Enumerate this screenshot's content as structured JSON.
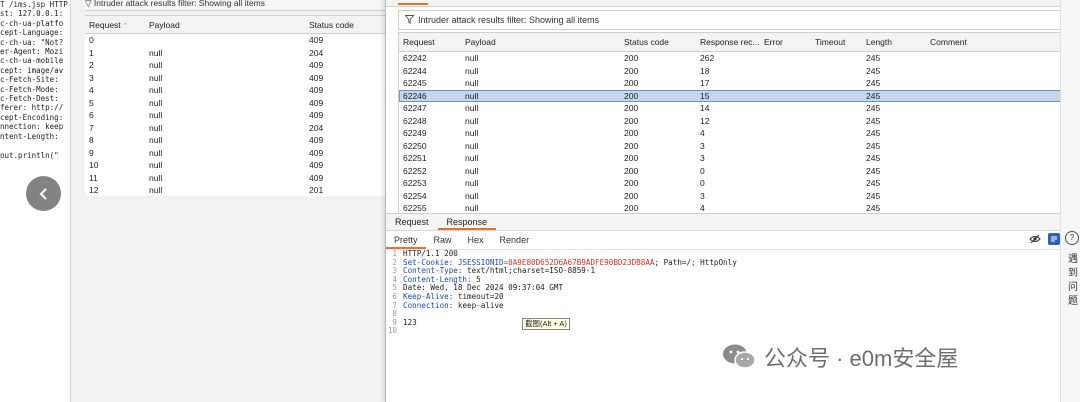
{
  "left_pane": {
    "lines": [
      "T /ims.jsp HTTP",
      "st: 127.0.0.1:",
      "c-ch-ua-platfo",
      "cept-Language:",
      "c-ch-ua: \"Not?",
      "er-Agent: Mozi",
      "c-ch-ua-mobile",
      "cept: image/av",
      "c-Fetch-Site:",
      "c-Fetch-Mode:",
      "c-Fetch-Dest:",
      "ferer: http://",
      "cept-Encoding:",
      "nnection: keep",
      "ntent-Length:"
    ],
    "code_line": " out.println(\""
  },
  "bg_window": {
    "filter_text": "Intruder attack results filter: Showing all items",
    "columns": [
      "Request",
      "Payload",
      "Status code"
    ],
    "rows": [
      [
        "0",
        "",
        "409"
      ],
      [
        "1",
        "null",
        "204"
      ],
      [
        "2",
        "null",
        "409"
      ],
      [
        "3",
        "null",
        "409"
      ],
      [
        "4",
        "null",
        "409"
      ],
      [
        "5",
        "null",
        "409"
      ],
      [
        "6",
        "null",
        "409"
      ],
      [
        "7",
        "null",
        "204"
      ],
      [
        "8",
        "null",
        "409"
      ],
      [
        "9",
        "null",
        "409"
      ],
      [
        "10",
        "null",
        "409"
      ],
      [
        "11",
        "null",
        "409"
      ],
      [
        "12",
        "null",
        "201"
      ]
    ]
  },
  "fg_window": {
    "filter_text": "Intruder attack results filter: Showing all items",
    "columns": [
      "Request",
      "Payload",
      "Status code",
      "Response rec...",
      "Error",
      "Timeout",
      "Length",
      "Comment"
    ],
    "rows": [
      [
        "62242",
        "null",
        "200",
        "262",
        "",
        "",
        "245",
        ""
      ],
      [
        "62244",
        "null",
        "200",
        "18",
        "",
        "",
        "245",
        ""
      ],
      [
        "62245",
        "null",
        "200",
        "17",
        "",
        "",
        "245",
        ""
      ],
      [
        "62246",
        "null",
        "200",
        "15",
        "",
        "",
        "245",
        ""
      ],
      [
        "62247",
        "null",
        "200",
        "14",
        "",
        "",
        "245",
        ""
      ],
      [
        "62248",
        "null",
        "200",
        "12",
        "",
        "",
        "245",
        ""
      ],
      [
        "62249",
        "null",
        "200",
        "4",
        "",
        "",
        "245",
        ""
      ],
      [
        "62250",
        "null",
        "200",
        "3",
        "",
        "",
        "245",
        ""
      ],
      [
        "62251",
        "null",
        "200",
        "3",
        "",
        "",
        "245",
        ""
      ],
      [
        "62252",
        "null",
        "200",
        "0",
        "",
        "",
        "245",
        ""
      ],
      [
        "62253",
        "null",
        "200",
        "0",
        "",
        "",
        "245",
        ""
      ],
      [
        "62254",
        "null",
        "200",
        "3",
        "",
        "",
        "245",
        ""
      ],
      [
        "62255",
        "null",
        "200",
        "4",
        "",
        "",
        "245",
        ""
      ]
    ],
    "selected_row": "62246",
    "panel_tabs": [
      "Request",
      "Response"
    ],
    "active_panel_tab": "Response",
    "sub_tabs": [
      "Pretty",
      "Raw",
      "Hex",
      "Render"
    ],
    "active_sub_tab": "Pretty",
    "response": {
      "status_line": "HTTP/1.1 200",
      "set_cookie_name": "Set-Cookie:",
      "set_cookie_id": "JSESSIONID",
      "set_cookie_value": "=0A9E80D652D6A67B9ADFE90BD23DB8AA",
      "set_cookie_rest": "; Path=/; HttpOnly",
      "content_type_name": "Content-Type:",
      "content_type_value": "text/html;charset=ISO-8859-1",
      "content_length_name": "Content-Length:",
      "content_length_value": "5",
      "date_line": "Date: Wed, 18 Dec 2024 09:37:04 GMT",
      "keep_alive_name": "Keep-Alive:",
      "keep_alive_value": "timeout=20",
      "connection_name": "Connection:",
      "connection_value": "keep-alive",
      "body": "123"
    },
    "tooltip": "截图(Alt + A)"
  },
  "right_bar": {
    "help": "?",
    "chars": [
      "遇",
      "到",
      "问",
      "题"
    ]
  },
  "watermark": {
    "text": "公众号 · e0m安全屋"
  },
  "colors": {
    "accent": "#e8722c",
    "selected_row": "#c5d6ec",
    "header_name": "#1b4aa8",
    "cookie_value": "#c0392b"
  }
}
